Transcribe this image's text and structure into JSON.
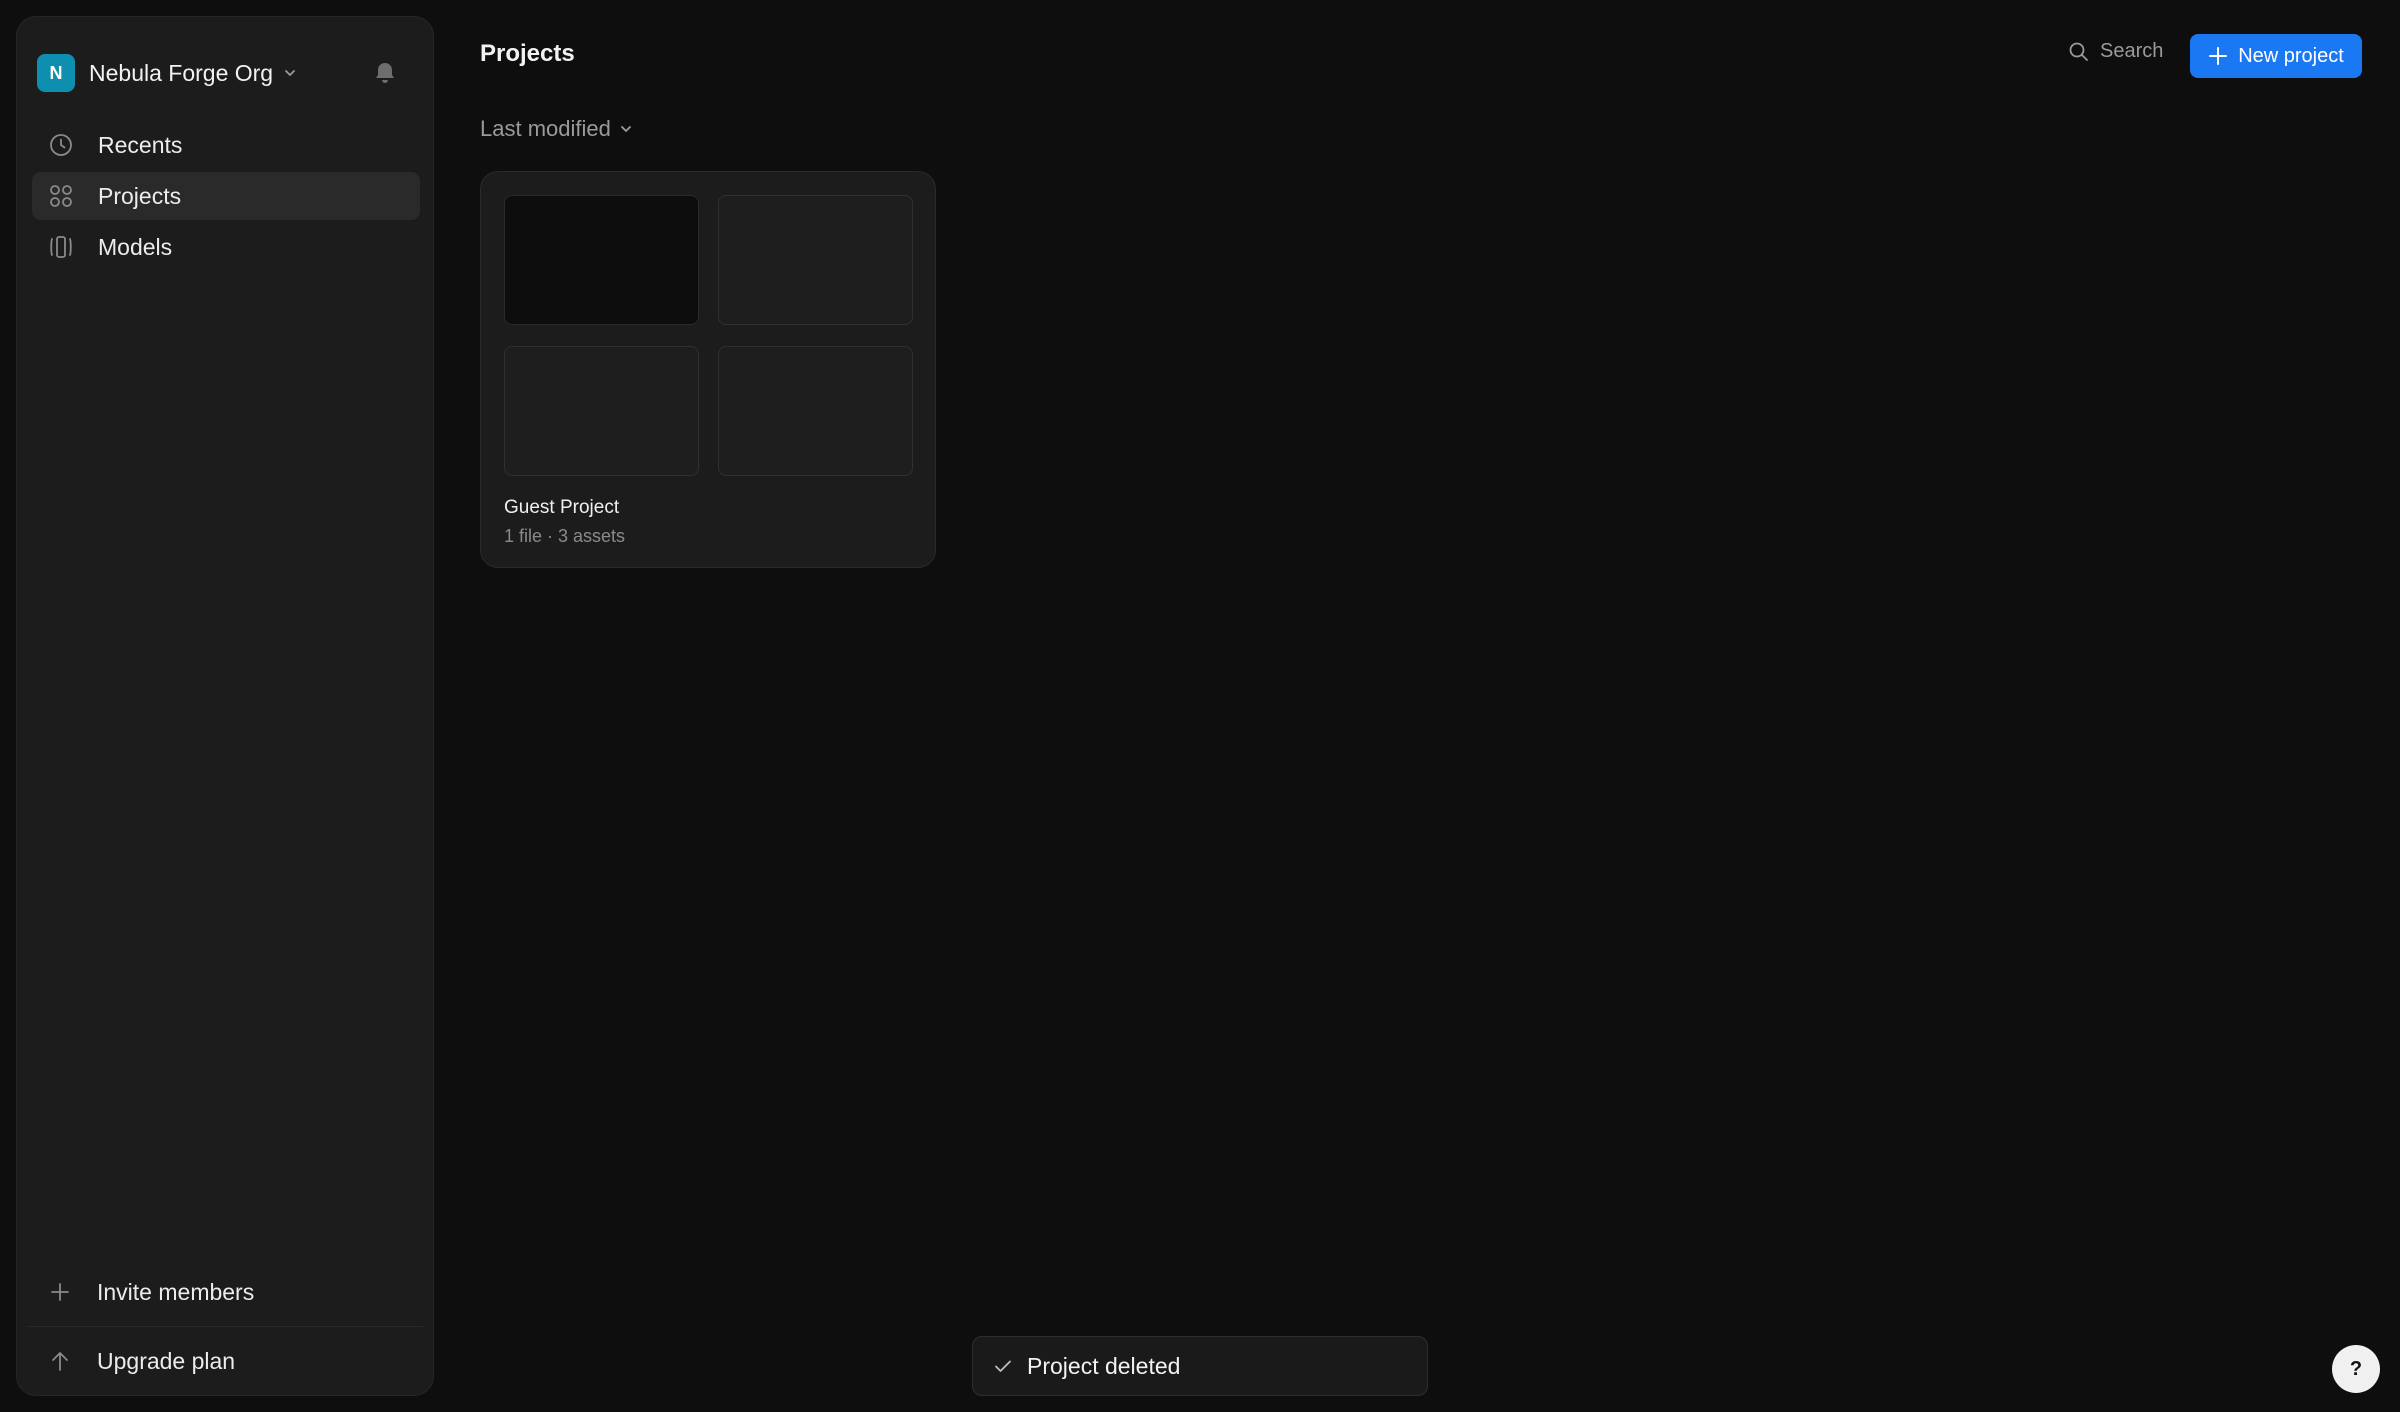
{
  "sidebar": {
    "org_initial": "N",
    "org_name": "Nebula Forge Org",
    "nav": [
      {
        "label": "Recents",
        "icon": "clock-icon"
      },
      {
        "label": "Projects",
        "icon": "grid-icon",
        "active": true
      },
      {
        "label": "Models",
        "icon": "models-icon"
      }
    ],
    "invite_label": "Invite members",
    "upgrade_label": "Upgrade plan"
  },
  "header": {
    "title": "Projects",
    "search_label": "Search",
    "new_project_label": "New project"
  },
  "sort": {
    "label": "Last modified"
  },
  "projects": [
    {
      "title": "Guest Project",
      "meta": "1 file · 3 assets"
    }
  ],
  "toast": {
    "message": "Project deleted"
  },
  "help": {
    "label": "?"
  },
  "colors": {
    "accent": "#1a78f2",
    "org_avatar": "#0f8fb0",
    "background": "#0e0e0e",
    "sidebar": "#1c1c1c"
  }
}
